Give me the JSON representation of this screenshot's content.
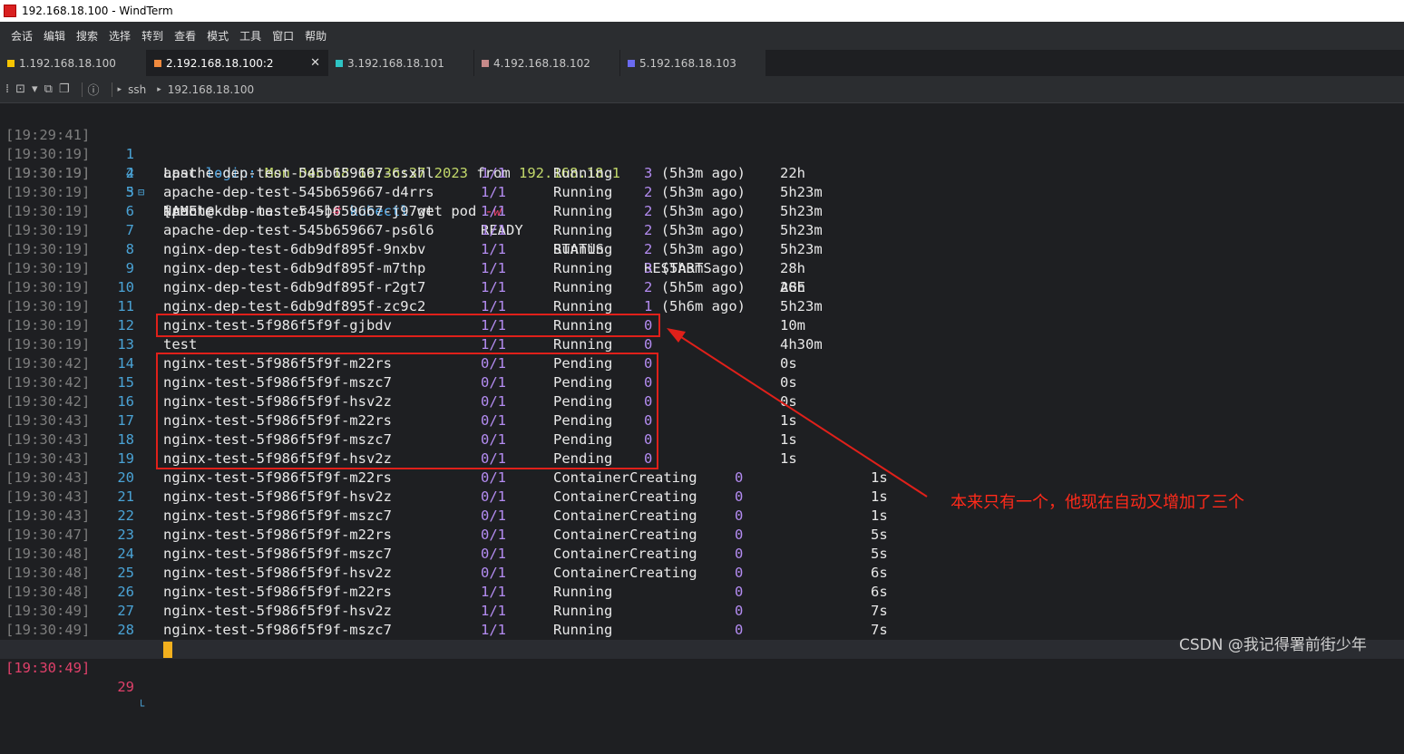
{
  "window": {
    "title": "192.168.18.100 - WindTerm"
  },
  "menu": [
    "会话",
    "编辑",
    "搜索",
    "选择",
    "转到",
    "查看",
    "模式",
    "工具",
    "窗口",
    "帮助"
  ],
  "tabs": [
    {
      "label": "1.192.168.18.100",
      "color": "#f5c400",
      "active": false
    },
    {
      "label": "2.192.168.18.100:2",
      "color": "#f08a3e",
      "active": true
    },
    {
      "label": "3.192.168.18.101",
      "color": "#2ec4c4",
      "active": false
    },
    {
      "label": "4.192.168.18.102",
      "color": "#c78a8a",
      "active": false
    },
    {
      "label": "5.192.168.18.103",
      "color": "#6a6af0",
      "active": false
    }
  ],
  "toolbar": {
    "path": [
      "ssh",
      "192.168.18.100"
    ]
  },
  "terminal": {
    "login": {
      "ts": "[19:29:41]",
      "n": "1",
      "last": "Last",
      "login_word": "login:",
      "date": "Mon Dec 18 19:36:37 2023",
      "from": "from",
      "ip": "192.168.18.1"
    },
    "prompt": {
      "ts": "[19:30:19]",
      "n": "2",
      "ps": "[root@kube-master ~]",
      "hash": "#",
      "cmd": "kubectl",
      "args": "get pod",
      "flag": "-w"
    },
    "header": {
      "ts": "[19:30:19]",
      "n": "3",
      "name": "NAME",
      "ready": "READY",
      "status": "STATUS",
      "restarts": "RESTARTS",
      "age": "AGE"
    },
    "rows": [
      {
        "ts": "[19:30:19]",
        "n": "4",
        "name": "apache-dep-test-545b659667-csxhl",
        "ready": "1/1",
        "status": "Running",
        "rc": "3",
        "rago": "(5h3m ago)",
        "age": "22h"
      },
      {
        "ts": "[19:30:19]",
        "n": "5",
        "name": "apache-dep-test-545b659667-d4rrs",
        "ready": "1/1",
        "status": "Running",
        "rc": "2",
        "rago": "(5h3m ago)",
        "age": "5h23m"
      },
      {
        "ts": "[19:30:19]",
        "n": "6",
        "name": "apache-dep-test-545b659667-j97wt",
        "ready": "1/1",
        "status": "Running",
        "rc": "2",
        "rago": "(5h3m ago)",
        "age": "5h23m"
      },
      {
        "ts": "[19:30:19]",
        "n": "7",
        "name": "apache-dep-test-545b659667-ps6l6",
        "ready": "1/1",
        "status": "Running",
        "rc": "2",
        "rago": "(5h3m ago)",
        "age": "5h23m"
      },
      {
        "ts": "[19:30:19]",
        "n": "8",
        "name": "nginx-dep-test-6db9df895f-9nxbv",
        "ready": "1/1",
        "status": "Running",
        "rc": "2",
        "rago": "(5h3m ago)",
        "age": "5h23m"
      },
      {
        "ts": "[19:30:19]",
        "n": "9",
        "name": "nginx-dep-test-6db9df895f-m7thp",
        "ready": "1/1",
        "status": "Running",
        "rc": "3",
        "rago": "(5h3m ago)",
        "age": "28h"
      },
      {
        "ts": "[19:30:19]",
        "n": "10",
        "name": "nginx-dep-test-6db9df895f-r2gt7",
        "ready": "1/1",
        "status": "Running",
        "rc": "2",
        "rago": "(5h5m ago)",
        "age": "28h"
      },
      {
        "ts": "[19:30:19]",
        "n": "11",
        "name": "nginx-dep-test-6db9df895f-zc9c2",
        "ready": "1/1",
        "status": "Running",
        "rc": "1",
        "rago": "(5h6m ago)",
        "age": "5h23m"
      },
      {
        "ts": "[19:30:19]",
        "n": "12",
        "name": "nginx-test-5f986f5f9f-gjbdv",
        "ready": "1/1",
        "status": "Running",
        "rc": "0",
        "rago": "",
        "age": "10m"
      },
      {
        "ts": "[19:30:19]",
        "n": "13",
        "name": "test",
        "ready": "1/1",
        "status": "Running",
        "rc": "0",
        "rago": "",
        "age": "4h30m"
      },
      {
        "ts": "[19:30:42]",
        "n": "14",
        "name": "nginx-test-5f986f5f9f-m22rs",
        "ready": "0/1",
        "status": "Pending",
        "rc": "0",
        "rago": "",
        "age": "0s"
      },
      {
        "ts": "[19:30:42]",
        "n": "15",
        "name": "nginx-test-5f986f5f9f-mszc7",
        "ready": "0/1",
        "status": "Pending",
        "rc": "0",
        "rago": "",
        "age": "0s"
      },
      {
        "ts": "[19:30:42]",
        "n": "16",
        "name": "nginx-test-5f986f5f9f-hsv2z",
        "ready": "0/1",
        "status": "Pending",
        "rc": "0",
        "rago": "",
        "age": "0s"
      },
      {
        "ts": "[19:30:43]",
        "n": "17",
        "name": "nginx-test-5f986f5f9f-m22rs",
        "ready": "0/1",
        "status": "Pending",
        "rc": "0",
        "rago": "",
        "age": "1s"
      },
      {
        "ts": "[19:30:43]",
        "n": "18",
        "name": "nginx-test-5f986f5f9f-mszc7",
        "ready": "0/1",
        "status": "Pending",
        "rc": "0",
        "rago": "",
        "age": "1s"
      },
      {
        "ts": "[19:30:43]",
        "n": "19",
        "name": "nginx-test-5f986f5f9f-hsv2z",
        "ready": "0/1",
        "status": "Pending",
        "rc": "0",
        "rago": "",
        "age": "1s"
      }
    ],
    "rows2": [
      {
        "ts": "[19:30:43]",
        "n": "20",
        "name": "nginx-test-5f986f5f9f-m22rs",
        "ready": "0/1",
        "status": "ContainerCreating",
        "rc": "0",
        "age": "1s"
      },
      {
        "ts": "[19:30:43]",
        "n": "21",
        "name": "nginx-test-5f986f5f9f-hsv2z",
        "ready": "0/1",
        "status": "ContainerCreating",
        "rc": "0",
        "age": "1s"
      },
      {
        "ts": "[19:30:43]",
        "n": "22",
        "name": "nginx-test-5f986f5f9f-mszc7",
        "ready": "0/1",
        "status": "ContainerCreating",
        "rc": "0",
        "age": "1s"
      },
      {
        "ts": "[19:30:47]",
        "n": "23",
        "name": "nginx-test-5f986f5f9f-m22rs",
        "ready": "0/1",
        "status": "ContainerCreating",
        "rc": "0",
        "age": "5s"
      },
      {
        "ts": "[19:30:48]",
        "n": "24",
        "name": "nginx-test-5f986f5f9f-mszc7",
        "ready": "0/1",
        "status": "ContainerCreating",
        "rc": "0",
        "age": "5s"
      },
      {
        "ts": "[19:30:48]",
        "n": "25",
        "name": "nginx-test-5f986f5f9f-hsv2z",
        "ready": "0/1",
        "status": "ContainerCreating",
        "rc": "0",
        "age": "6s"
      },
      {
        "ts": "[19:30:48]",
        "n": "26",
        "name": "nginx-test-5f986f5f9f-m22rs",
        "ready": "1/1",
        "status": "Running",
        "rc": "0",
        "age": "6s"
      },
      {
        "ts": "[19:30:49]",
        "n": "27",
        "name": "nginx-test-5f986f5f9f-hsv2z",
        "ready": "1/1",
        "status": "Running",
        "rc": "0",
        "age": "7s"
      },
      {
        "ts": "[19:30:49]",
        "n": "28",
        "name": "nginx-test-5f986f5f9f-mszc7",
        "ready": "1/1",
        "status": "Running",
        "rc": "0",
        "age": "7s"
      }
    ],
    "current": {
      "ts": "[19:30:49]",
      "n": "29"
    }
  },
  "annotation": "本来只有一个，他现在自动又增加了三个",
  "watermark": "CSDN @我记得署前街少年",
  "colors": {
    "accent_red": "#e0201a",
    "number_purple": "#b48cf2",
    "cursor": "#f2b01e"
  }
}
